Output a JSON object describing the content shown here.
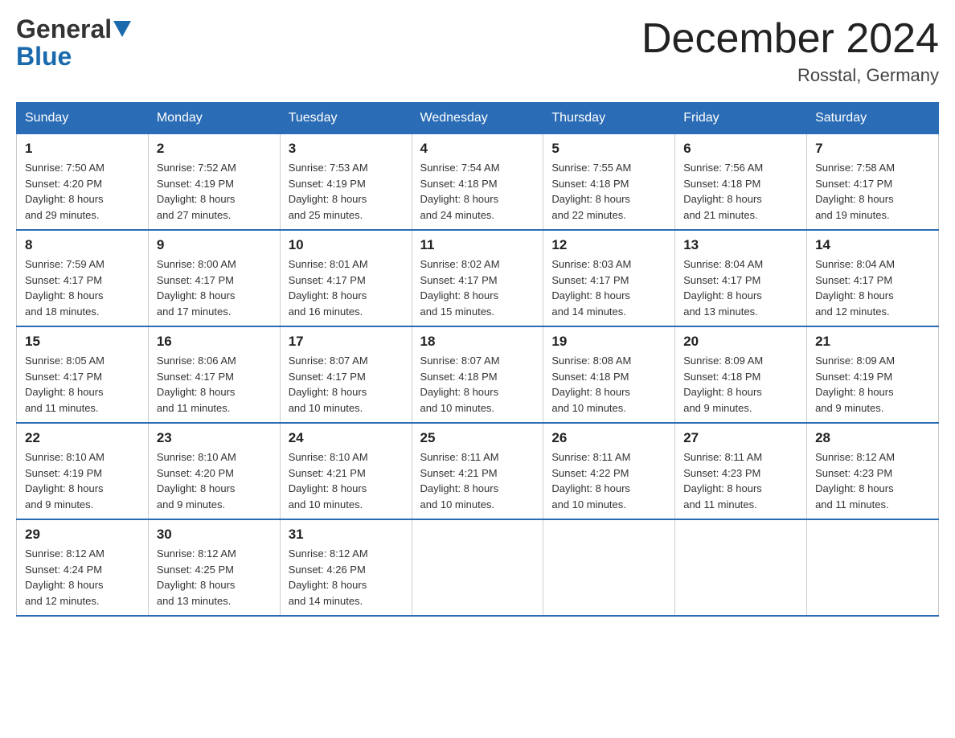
{
  "header": {
    "logo_line1": "General",
    "logo_line2": "Blue",
    "month_title": "December 2024",
    "location": "Rosstal, Germany"
  },
  "columns": [
    "Sunday",
    "Monday",
    "Tuesday",
    "Wednesday",
    "Thursday",
    "Friday",
    "Saturday"
  ],
  "weeks": [
    [
      {
        "day": "1",
        "info": "Sunrise: 7:50 AM\nSunset: 4:20 PM\nDaylight: 8 hours\nand 29 minutes."
      },
      {
        "day": "2",
        "info": "Sunrise: 7:52 AM\nSunset: 4:19 PM\nDaylight: 8 hours\nand 27 minutes."
      },
      {
        "day": "3",
        "info": "Sunrise: 7:53 AM\nSunset: 4:19 PM\nDaylight: 8 hours\nand 25 minutes."
      },
      {
        "day": "4",
        "info": "Sunrise: 7:54 AM\nSunset: 4:18 PM\nDaylight: 8 hours\nand 24 minutes."
      },
      {
        "day": "5",
        "info": "Sunrise: 7:55 AM\nSunset: 4:18 PM\nDaylight: 8 hours\nand 22 minutes."
      },
      {
        "day": "6",
        "info": "Sunrise: 7:56 AM\nSunset: 4:18 PM\nDaylight: 8 hours\nand 21 minutes."
      },
      {
        "day": "7",
        "info": "Sunrise: 7:58 AM\nSunset: 4:17 PM\nDaylight: 8 hours\nand 19 minutes."
      }
    ],
    [
      {
        "day": "8",
        "info": "Sunrise: 7:59 AM\nSunset: 4:17 PM\nDaylight: 8 hours\nand 18 minutes."
      },
      {
        "day": "9",
        "info": "Sunrise: 8:00 AM\nSunset: 4:17 PM\nDaylight: 8 hours\nand 17 minutes."
      },
      {
        "day": "10",
        "info": "Sunrise: 8:01 AM\nSunset: 4:17 PM\nDaylight: 8 hours\nand 16 minutes."
      },
      {
        "day": "11",
        "info": "Sunrise: 8:02 AM\nSunset: 4:17 PM\nDaylight: 8 hours\nand 15 minutes."
      },
      {
        "day": "12",
        "info": "Sunrise: 8:03 AM\nSunset: 4:17 PM\nDaylight: 8 hours\nand 14 minutes."
      },
      {
        "day": "13",
        "info": "Sunrise: 8:04 AM\nSunset: 4:17 PM\nDaylight: 8 hours\nand 13 minutes."
      },
      {
        "day": "14",
        "info": "Sunrise: 8:04 AM\nSunset: 4:17 PM\nDaylight: 8 hours\nand 12 minutes."
      }
    ],
    [
      {
        "day": "15",
        "info": "Sunrise: 8:05 AM\nSunset: 4:17 PM\nDaylight: 8 hours\nand 11 minutes."
      },
      {
        "day": "16",
        "info": "Sunrise: 8:06 AM\nSunset: 4:17 PM\nDaylight: 8 hours\nand 11 minutes."
      },
      {
        "day": "17",
        "info": "Sunrise: 8:07 AM\nSunset: 4:17 PM\nDaylight: 8 hours\nand 10 minutes."
      },
      {
        "day": "18",
        "info": "Sunrise: 8:07 AM\nSunset: 4:18 PM\nDaylight: 8 hours\nand 10 minutes."
      },
      {
        "day": "19",
        "info": "Sunrise: 8:08 AM\nSunset: 4:18 PM\nDaylight: 8 hours\nand 10 minutes."
      },
      {
        "day": "20",
        "info": "Sunrise: 8:09 AM\nSunset: 4:18 PM\nDaylight: 8 hours\nand 9 minutes."
      },
      {
        "day": "21",
        "info": "Sunrise: 8:09 AM\nSunset: 4:19 PM\nDaylight: 8 hours\nand 9 minutes."
      }
    ],
    [
      {
        "day": "22",
        "info": "Sunrise: 8:10 AM\nSunset: 4:19 PM\nDaylight: 8 hours\nand 9 minutes."
      },
      {
        "day": "23",
        "info": "Sunrise: 8:10 AM\nSunset: 4:20 PM\nDaylight: 8 hours\nand 9 minutes."
      },
      {
        "day": "24",
        "info": "Sunrise: 8:10 AM\nSunset: 4:21 PM\nDaylight: 8 hours\nand 10 minutes."
      },
      {
        "day": "25",
        "info": "Sunrise: 8:11 AM\nSunset: 4:21 PM\nDaylight: 8 hours\nand 10 minutes."
      },
      {
        "day": "26",
        "info": "Sunrise: 8:11 AM\nSunset: 4:22 PM\nDaylight: 8 hours\nand 10 minutes."
      },
      {
        "day": "27",
        "info": "Sunrise: 8:11 AM\nSunset: 4:23 PM\nDaylight: 8 hours\nand 11 minutes."
      },
      {
        "day": "28",
        "info": "Sunrise: 8:12 AM\nSunset: 4:23 PM\nDaylight: 8 hours\nand 11 minutes."
      }
    ],
    [
      {
        "day": "29",
        "info": "Sunrise: 8:12 AM\nSunset: 4:24 PM\nDaylight: 8 hours\nand 12 minutes."
      },
      {
        "day": "30",
        "info": "Sunrise: 8:12 AM\nSunset: 4:25 PM\nDaylight: 8 hours\nand 13 minutes."
      },
      {
        "day": "31",
        "info": "Sunrise: 8:12 AM\nSunset: 4:26 PM\nDaylight: 8 hours\nand 14 minutes."
      },
      {
        "day": "",
        "info": ""
      },
      {
        "day": "",
        "info": ""
      },
      {
        "day": "",
        "info": ""
      },
      {
        "day": "",
        "info": ""
      }
    ]
  ]
}
